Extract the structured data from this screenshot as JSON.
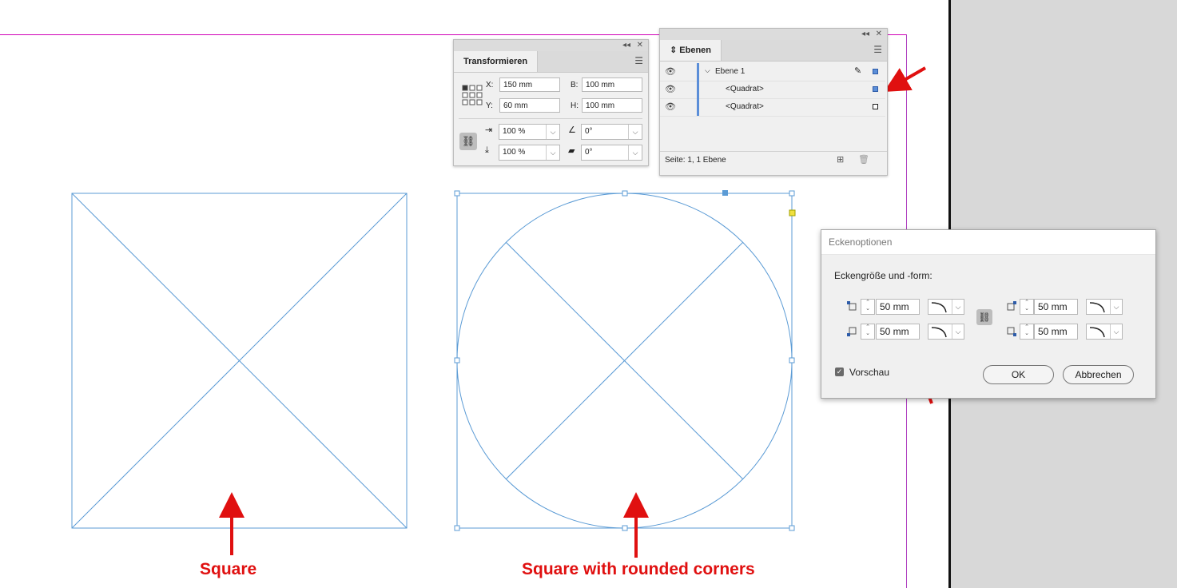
{
  "transform_panel": {
    "tab": "Transformieren",
    "x_label": "X:",
    "x_value": "150 mm",
    "y_label": "Y:",
    "y_value": "60 mm",
    "w_label": "B:",
    "w_value": "100 mm",
    "h_label": "H:",
    "h_value": "100 mm",
    "scale_x": "100 %",
    "scale_y": "100 %",
    "rotation": "0°",
    "shear": "0°"
  },
  "layers_panel": {
    "tab": "Ebenen",
    "layers": [
      {
        "name": "Ebene 1"
      },
      {
        "name": "<Quadrat>"
      },
      {
        "name": "<Quadrat>"
      }
    ],
    "footer": "Seite: 1, 1 Ebene"
  },
  "corner_dialog": {
    "title": "Eckenoptionen",
    "heading": "Eckengröße und -form:",
    "top_left": "50 mm",
    "bottom_left": "50 mm",
    "top_right": "50 mm",
    "bottom_right": "50 mm",
    "preview_label": "Vorschau",
    "preview_checked": true,
    "ok_label": "OK",
    "cancel_label": "Abbrechen"
  },
  "annotations": {
    "left": "Square",
    "right": "Square with rounded corners"
  },
  "colors": {
    "frame": "#5b9bd5",
    "annotation": "#e01010",
    "guide": "#d000b8"
  }
}
